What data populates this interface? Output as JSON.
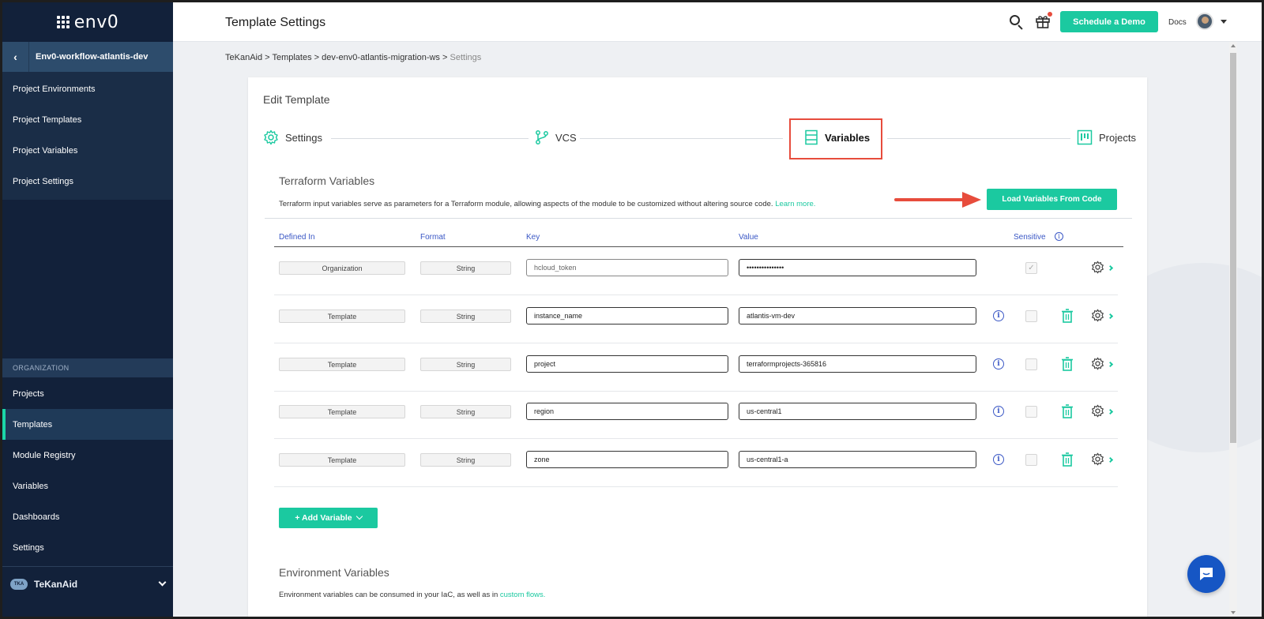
{
  "app": {
    "logo_text": "env0"
  },
  "header": {
    "title": "Template Settings",
    "demo_button": "Schedule a Demo",
    "docs_link": "Docs"
  },
  "sidebar": {
    "project_name": "Env0-workflow-atlantis-dev",
    "project_items": [
      {
        "label": "Project Environments"
      },
      {
        "label": "Project Templates"
      },
      {
        "label": "Project Variables"
      },
      {
        "label": "Project Settings"
      }
    ],
    "org_header": "ORGANIZATION",
    "org_items": [
      {
        "label": "Projects"
      },
      {
        "label": "Templates",
        "active": true
      },
      {
        "label": "Module Registry"
      },
      {
        "label": "Variables"
      },
      {
        "label": "Dashboards"
      },
      {
        "label": "Settings"
      }
    ],
    "org_name": "TeKanAid",
    "org_logo_text": "TKA"
  },
  "breadcrumb": {
    "items": [
      "TeKanAid",
      "Templates",
      "dev-env0-atlantis-migration-ws"
    ],
    "current": "Settings",
    "separator": ">"
  },
  "card": {
    "title": "Edit Template",
    "steps": [
      {
        "label": "Settings",
        "icon": "gear-icon"
      },
      {
        "label": "VCS",
        "icon": "branch-icon"
      },
      {
        "label": "Variables",
        "icon": "variables-icon",
        "active": true
      },
      {
        "label": "Projects",
        "icon": "projects-icon"
      }
    ],
    "terraform": {
      "title": "Terraform Variables",
      "description": "Terraform input variables serve as parameters for a Terraform module, allowing aspects of the module to be customized without altering source code.",
      "learn_more": "Learn more.",
      "load_button": "Load Variables From Code"
    },
    "columns": {
      "defined_in": "Defined In",
      "format": "Format",
      "key": "Key",
      "value": "Value",
      "sensitive": "Sensitive"
    },
    "rows": [
      {
        "defined_in": "Organization",
        "format": "String",
        "key": "hcloud_token",
        "value": "•••••••••••••••",
        "sensitive": true,
        "deletable": false
      },
      {
        "defined_in": "Template",
        "format": "String",
        "key": "instance_name",
        "value": "atlantis-vm-dev",
        "sensitive": false,
        "deletable": true
      },
      {
        "defined_in": "Template",
        "format": "String",
        "key": "project",
        "value": "terraformprojects-365816",
        "sensitive": false,
        "deletable": true
      },
      {
        "defined_in": "Template",
        "format": "String",
        "key": "region",
        "value": "us-central1",
        "sensitive": false,
        "deletable": true
      },
      {
        "defined_in": "Template",
        "format": "String",
        "key": "zone",
        "value": "us-central1-a",
        "sensitive": false,
        "deletable": true
      }
    ],
    "add_button": "+ Add Variable",
    "environment": {
      "title": "Environment Variables",
      "description": "Environment variables can be consumed in your IaC, as well as in",
      "link": "custom flows."
    }
  },
  "colors": {
    "accent": "#1bc9a0",
    "sidebar_bg": "#12213a",
    "link_blue": "#3a57c5",
    "highlight_red": "#e74c3c"
  }
}
